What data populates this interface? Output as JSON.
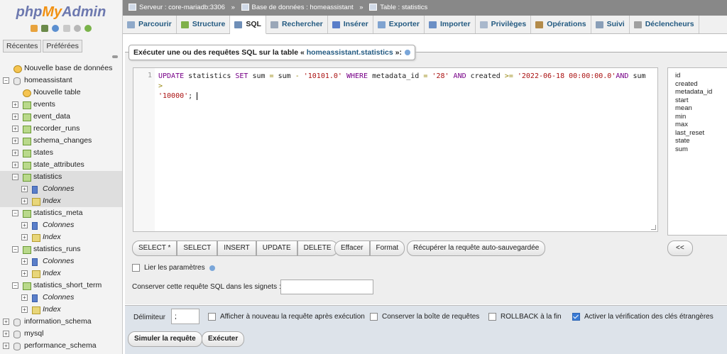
{
  "sidebar": {
    "logo": {
      "php": "php",
      "my": "My",
      "admin": "Admin"
    },
    "tabs": [
      "Récentes",
      "Préférées"
    ],
    "tree": [
      {
        "label": "Nouvelle base de données",
        "type": "new",
        "level": 0,
        "exp": ""
      },
      {
        "label": "homeassistant",
        "type": "db",
        "level": 0,
        "exp": "−"
      },
      {
        "label": "Nouvelle table",
        "type": "new",
        "level": 1,
        "exp": ""
      },
      {
        "label": "events",
        "type": "tbl",
        "level": 1,
        "exp": "+"
      },
      {
        "label": "event_data",
        "type": "tbl",
        "level": 1,
        "exp": "+"
      },
      {
        "label": "recorder_runs",
        "type": "tbl",
        "level": 1,
        "exp": "+"
      },
      {
        "label": "schema_changes",
        "type": "tbl",
        "level": 1,
        "exp": "+"
      },
      {
        "label": "states",
        "type": "tbl",
        "level": 1,
        "exp": "+"
      },
      {
        "label": "state_attributes",
        "type": "tbl",
        "level": 1,
        "exp": "+"
      },
      {
        "label": "statistics",
        "type": "tbl",
        "level": 1,
        "exp": "−",
        "selected": true
      },
      {
        "label": "Colonnes",
        "type": "col",
        "level": 2,
        "exp": "+",
        "italic": true,
        "selected": true
      },
      {
        "label": "Index",
        "type": "idx",
        "level": 2,
        "exp": "+",
        "italic": true,
        "selected": true
      },
      {
        "label": "statistics_meta",
        "type": "tbl",
        "level": 1,
        "exp": "−"
      },
      {
        "label": "Colonnes",
        "type": "col",
        "level": 2,
        "exp": "+",
        "italic": true
      },
      {
        "label": "Index",
        "type": "idx",
        "level": 2,
        "exp": "+",
        "italic": true
      },
      {
        "label": "statistics_runs",
        "type": "tbl",
        "level": 1,
        "exp": "−"
      },
      {
        "label": "Colonnes",
        "type": "col",
        "level": 2,
        "exp": "+",
        "italic": true
      },
      {
        "label": "Index",
        "type": "idx",
        "level": 2,
        "exp": "+",
        "italic": true
      },
      {
        "label": "statistics_short_term",
        "type": "tbl",
        "level": 1,
        "exp": "−"
      },
      {
        "label": "Colonnes",
        "type": "col",
        "level": 2,
        "exp": "+",
        "italic": true
      },
      {
        "label": "Index",
        "type": "idx",
        "level": 2,
        "exp": "+",
        "italic": true
      },
      {
        "label": "information_schema",
        "type": "db",
        "level": 0,
        "exp": "+"
      },
      {
        "label": "mysql",
        "type": "db",
        "level": 0,
        "exp": "+"
      },
      {
        "label": "performance_schema",
        "type": "db",
        "level": 0,
        "exp": "+"
      }
    ]
  },
  "breadcrumb": {
    "server": "Serveur : core-mariadb:3306",
    "database": "Base de données : homeassistant",
    "table": "Table : statistics",
    "separator": "»"
  },
  "tabs": [
    {
      "label": "Parcourir",
      "color": "#8fa9c9"
    },
    {
      "label": "Structure",
      "color": "#7fb04a"
    },
    {
      "label": "SQL",
      "color": "#6f8fb8",
      "active": true
    },
    {
      "label": "Rechercher",
      "color": "#9aa7b8"
    },
    {
      "label": "Insérer",
      "color": "#5a7ec9"
    },
    {
      "label": "Exporter",
      "color": "#7fa3d0"
    },
    {
      "label": "Importer",
      "color": "#6b8fc5"
    },
    {
      "label": "Privilèges",
      "color": "#a9b8cc"
    },
    {
      "label": "Opérations",
      "color": "#b38b4a"
    },
    {
      "label": "Suivi",
      "color": "#8a9fb8"
    },
    {
      "label": "Déclencheurs",
      "color": "#a0a0a0"
    }
  ],
  "query_panel": {
    "legend_prefix": "Exécuter une ou des requêtes SQL sur la table « ",
    "legend_table": "homeassistant.statistics",
    "legend_suffix": " »:",
    "line_number": "1",
    "code": {
      "t1": "UPDATE",
      "t2": " statistics ",
      "t3": "SET",
      "t4": " sum ",
      "t5": "=",
      "t6": " sum ",
      "t7": "-",
      "t8": " ",
      "t9": "'10101.0'",
      "t10": " ",
      "t11": "WHERE",
      "t12": " metadata_id ",
      "t13": "=",
      "t14": " ",
      "t15": "'28'",
      "t16": " ",
      "t17": "AND",
      "t18": " created ",
      "t19": ">=",
      "t20": " ",
      "t21": "'2022-06-18 00:00:00.0'",
      "t22": "AND",
      "t23": " sum ",
      "t24": ">",
      "t25": "\n",
      "t26": "'10000'",
      "t27": "; "
    },
    "columns": [
      "id",
      "created",
      "metadata_id",
      "start",
      "mean",
      "min",
      "max",
      "last_reset",
      "state",
      "sum"
    ]
  },
  "buttons": {
    "select_star": "SELECT *",
    "select": "SELECT",
    "insert": "INSERT",
    "update": "UPDATE",
    "delete": "DELETE",
    "clear": "Effacer",
    "format": "Format",
    "recover": "Récupérer la requête auto-sauvegardée",
    "collapse": "<<"
  },
  "params": {
    "bind_label": "Lier les paramètres",
    "bookmark_label": "Conserver cette requête SQL dans les signets :",
    "bookmark_value": ""
  },
  "options": {
    "delimiter_label": "Délimiteur",
    "delimiter_value": ";",
    "show_again": "Afficher à nouveau la requête après exécution",
    "keep_box": "Conserver la boîte de requêtes",
    "rollback": "ROLLBACK à la fin",
    "fk_check": "Activer la vérification des clés étrangères",
    "fk_checked": true
  },
  "submit": {
    "simulate": "Simuler la requête",
    "execute": "Exécuter"
  }
}
